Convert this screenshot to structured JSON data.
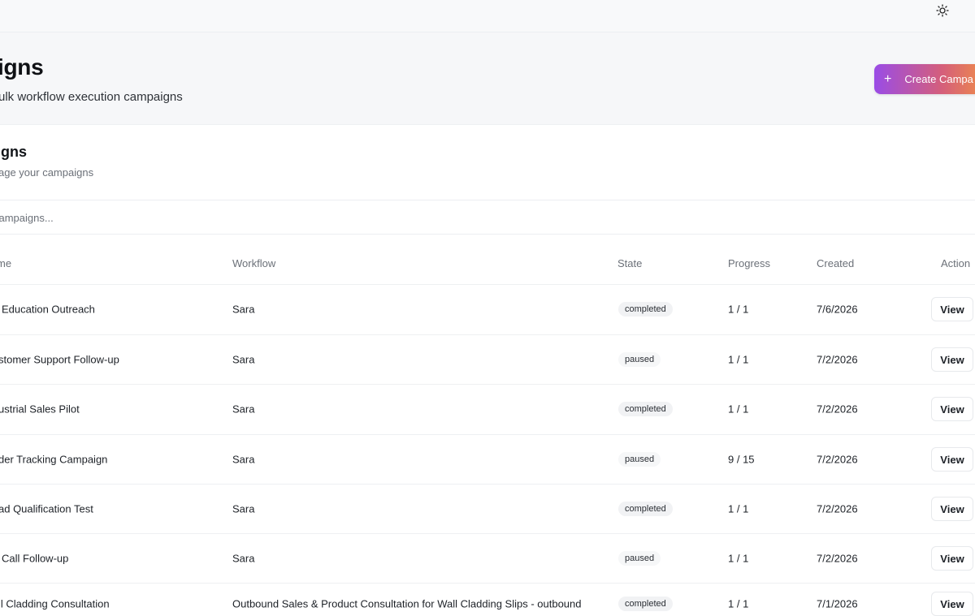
{
  "icons": {
    "theme_toggle": "sun-icon",
    "create_button": "plus-icon"
  },
  "colors": {
    "accent_start": "#9a4ce6",
    "accent_mid": "#d55f7a",
    "accent_end": "#f08e47"
  },
  "header": {
    "title": "igns",
    "subtitle": "ulk workflow execution campaigns",
    "create_label": "Create Campa"
  },
  "card": {
    "title": "igns",
    "subtitle": "age your campaigns"
  },
  "search": {
    "placeholder": "campaigns..."
  },
  "table": {
    "columns": [
      "me",
      "Workflow",
      "State",
      "Progress",
      "Created",
      "Action"
    ],
    "rows": [
      {
        "name": "Education Outreach",
        "workflow": "Sara",
        "state": "completed",
        "progress": "1 / 1",
        "created": "7/6/2026",
        "action": "View"
      },
      {
        "name": "stomer Support Follow-up",
        "workflow": "Sara",
        "state": "paused",
        "progress": "1 / 1",
        "created": "7/2/2026",
        "action": "View"
      },
      {
        "name": "ustrial Sales Pilot",
        "workflow": "Sara",
        "state": "completed",
        "progress": "1 / 1",
        "created": "7/2/2026",
        "action": "View"
      },
      {
        "name": "der Tracking Campaign",
        "workflow": "Sara",
        "state": "paused",
        "progress": "9 / 15",
        "created": "7/2/2026",
        "action": "View"
      },
      {
        "name": "ad Qualification Test",
        "workflow": "Sara",
        "state": "completed",
        "progress": "1 / 1",
        "created": "7/2/2026",
        "action": "View"
      },
      {
        "name": "Call Follow-up",
        "workflow": "Sara",
        "state": "paused",
        "progress": "1 / 1",
        "created": "7/2/2026",
        "action": "View"
      },
      {
        "name": "ll Cladding Consultation",
        "workflow": "Outbound Sales & Product Consultation for Wall Cladding Slips - outbound",
        "state": "completed",
        "progress": "1 / 1",
        "created": "7/1/2026",
        "action": "View"
      }
    ]
  }
}
